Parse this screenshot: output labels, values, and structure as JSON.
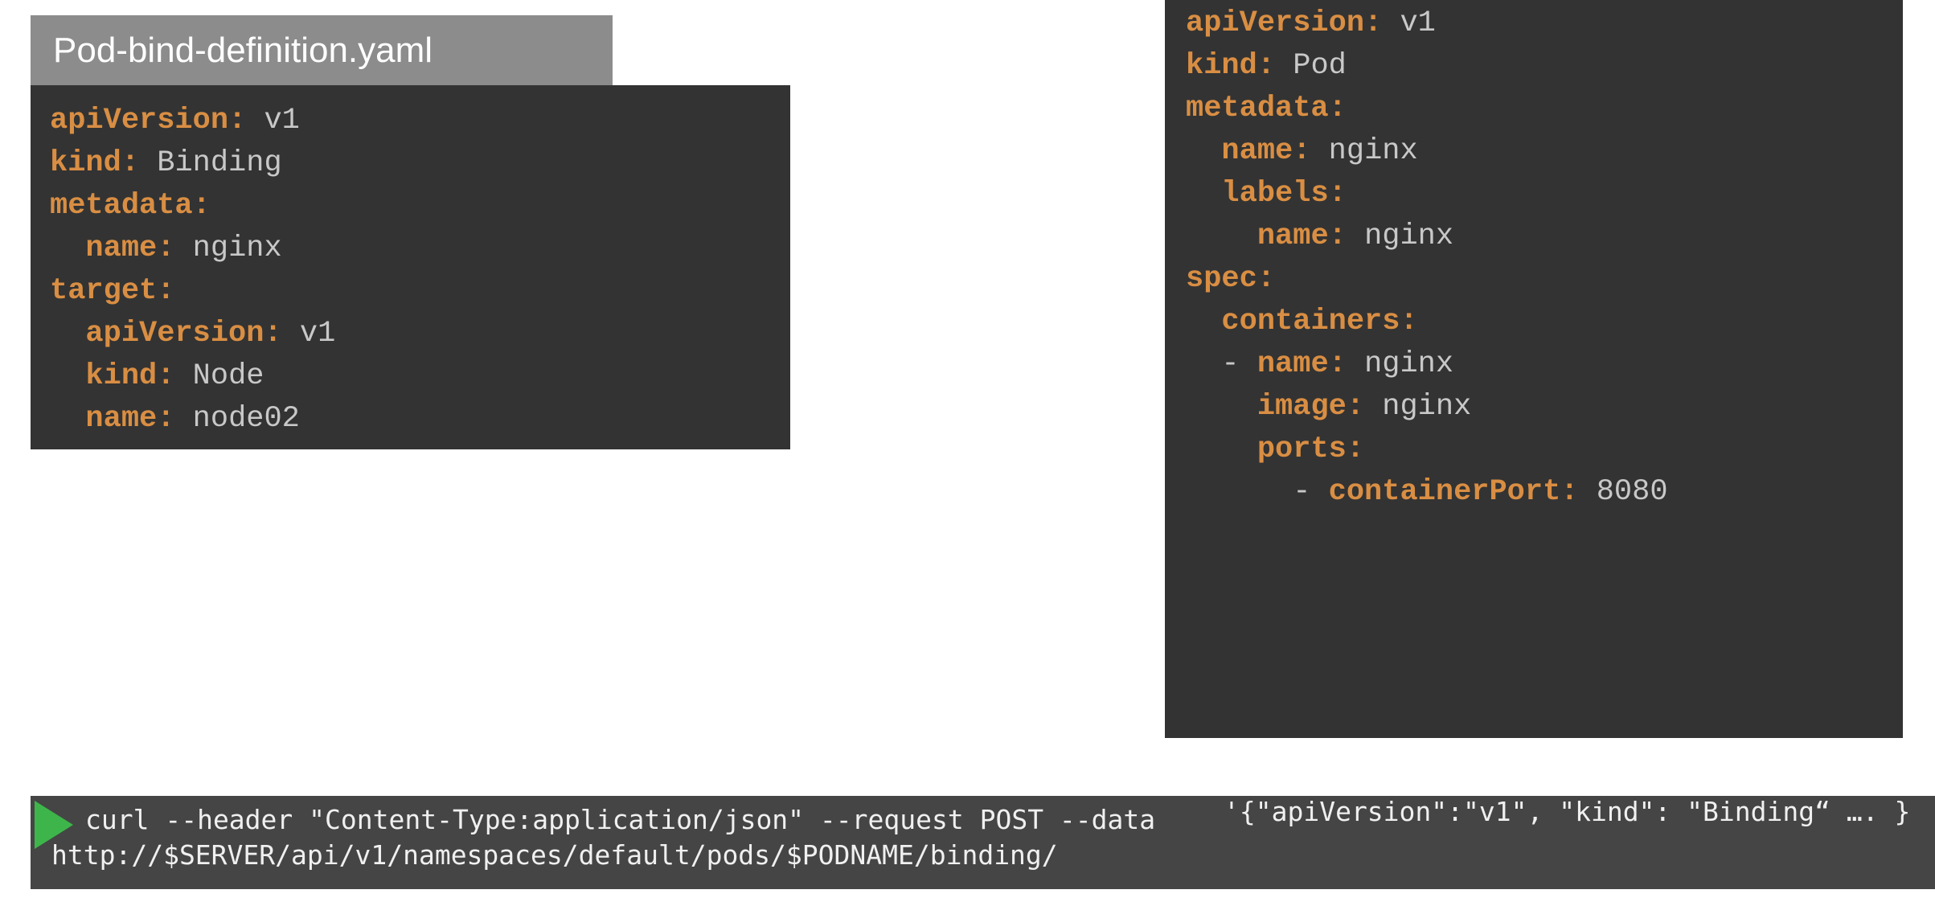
{
  "binding_file": {
    "title": "Pod-bind-definition.yaml",
    "lines": [
      {
        "indent": "",
        "key": "apiVersion:",
        "value": " v1"
      },
      {
        "indent": "",
        "key": "kind:",
        "value": " Binding"
      },
      {
        "indent": "",
        "key": "metadata:",
        "value": ""
      },
      {
        "indent": "  ",
        "key": "name:",
        "value": " nginx"
      },
      {
        "indent": "",
        "key": "target:",
        "value": ""
      },
      {
        "indent": "  ",
        "key": "apiVersion:",
        "value": " v1"
      },
      {
        "indent": "  ",
        "key": "kind:",
        "value": " Node"
      },
      {
        "indent": "  ",
        "key": "name:",
        "value": " node02"
      }
    ]
  },
  "pod_file": {
    "lines": [
      {
        "indent": "",
        "key": "apiVersion:",
        "value": " v1"
      },
      {
        "indent": "",
        "key": "kind:",
        "value": " Pod"
      },
      {
        "indent": "",
        "key": "metadata:",
        "value": ""
      },
      {
        "indent": "  ",
        "key": "name:",
        "value": " nginx"
      },
      {
        "indent": "  ",
        "key": "labels:",
        "value": ""
      },
      {
        "indent": "    ",
        "key": "name:",
        "value": " nginx"
      },
      {
        "indent": "",
        "key": "spec:",
        "value": ""
      },
      {
        "indent": "  ",
        "key": "containers:",
        "value": ""
      },
      {
        "indent": "  - ",
        "key": "name:",
        "value": " nginx"
      },
      {
        "indent": "    ",
        "key": "image:",
        "value": " nginx"
      },
      {
        "indent": "    ",
        "key": "ports:",
        "value": ""
      },
      {
        "indent": "      - ",
        "key": "containerPort:",
        "value": " 8080"
      }
    ]
  },
  "command": {
    "icon": "play-icon",
    "line1": "curl --header \"Content-Type:application/json\" --request POST --data",
    "data_arg": "'{\"apiVersion\":\"v1\", \"kind\": \"Binding“ …. }",
    "line2": "http://$SERVER/api/v1/namespaces/default/pods/$PODNAME/binding/"
  },
  "colors": {
    "key": "#d98e43",
    "value": "#c8c8c8",
    "code_bg": "#333333",
    "tab_bg": "#8c8c8c",
    "play": "#3db54a"
  }
}
